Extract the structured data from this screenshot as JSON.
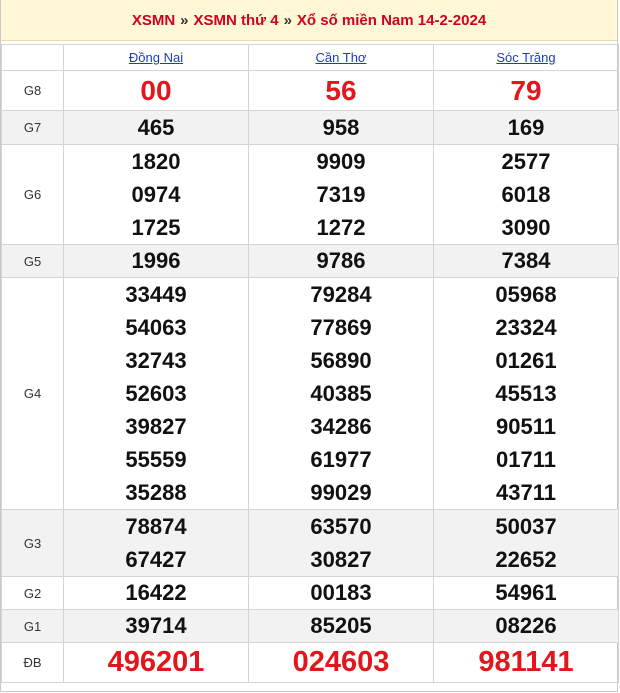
{
  "breadcrumb": {
    "home": "XSMN",
    "separator": "»",
    "day": "XSMN thứ 4",
    "current": "Xổ số miền Nam 14-2-2024"
  },
  "provinces": [
    "Đồng Nai",
    "Cần Thơ",
    "Sóc Trăng"
  ],
  "prizes": [
    {
      "key": "g8",
      "label": "G8",
      "results": [
        [
          "00"
        ],
        [
          "56"
        ],
        [
          "79"
        ]
      ]
    },
    {
      "key": "g7",
      "label": "G7",
      "results": [
        [
          "465"
        ],
        [
          "958"
        ],
        [
          "169"
        ]
      ]
    },
    {
      "key": "g6",
      "label": "G6",
      "results": [
        [
          "1820",
          "0974",
          "1725"
        ],
        [
          "9909",
          "7319",
          "1272"
        ],
        [
          "2577",
          "6018",
          "3090"
        ]
      ]
    },
    {
      "key": "g5",
      "label": "G5",
      "results": [
        [
          "1996"
        ],
        [
          "9786"
        ],
        [
          "7384"
        ]
      ]
    },
    {
      "key": "g4",
      "label": "G4",
      "results": [
        [
          "33449",
          "54063",
          "32743",
          "52603",
          "39827",
          "55559",
          "35288"
        ],
        [
          "79284",
          "77869",
          "56890",
          "40385",
          "34286",
          "61977",
          "99029"
        ],
        [
          "05968",
          "23324",
          "01261",
          "45513",
          "90511",
          "01711",
          "43711"
        ]
      ]
    },
    {
      "key": "g3",
      "label": "G3",
      "results": [
        [
          "78874",
          "67427"
        ],
        [
          "63570",
          "30827"
        ],
        [
          "50037",
          "22652"
        ]
      ]
    },
    {
      "key": "g2",
      "label": "G2",
      "results": [
        [
          "16422"
        ],
        [
          "00183"
        ],
        [
          "54961"
        ]
      ]
    },
    {
      "key": "g1",
      "label": "G1",
      "results": [
        [
          "39714"
        ],
        [
          "85205"
        ],
        [
          "08226"
        ]
      ]
    },
    {
      "key": "db",
      "label": "ĐB",
      "results": [
        [
          "496201"
        ],
        [
          "024603"
        ],
        [
          "981141"
        ]
      ]
    }
  ],
  "colors": {
    "accent_red": "#e3161c",
    "link_blue": "#1a3fb5",
    "breadcrumb_bg": "#fff7d6"
  }
}
